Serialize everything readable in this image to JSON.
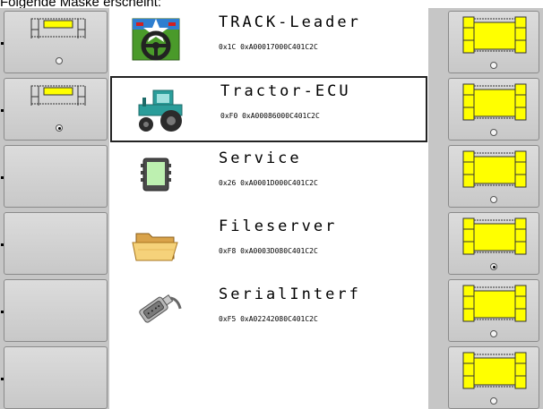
{
  "caption": "Folgende Maske erscheint:",
  "devices": [
    {
      "title": "TRACK-Leader",
      "addr": "0x1C 0xA00017000C401C2C",
      "icon": "steering-wheel-icon"
    },
    {
      "title": "Tractor-ECU",
      "addr": "0xF0 0xA00086000C401C2C",
      "icon": "tractor-icon"
    },
    {
      "title": "Service",
      "addr": "0x26 0xA0001D000C401C2C",
      "icon": "terminal-icon"
    },
    {
      "title": "Fileserver",
      "addr": "0xF8 0xA0003D080C401C2C",
      "icon": "folder-icon"
    },
    {
      "title": "SerialInterf",
      "addr": "0xF5 0xA02242080C401C2C",
      "icon": "serial-plug-icon"
    }
  ],
  "left_softkeys": [
    {
      "icon": "boom-small-icon",
      "radio": "off"
    },
    {
      "icon": "boom-small-icon",
      "radio": "on"
    },
    {
      "icon": "",
      "radio": ""
    },
    {
      "icon": "",
      "radio": ""
    },
    {
      "icon": "",
      "radio": ""
    },
    {
      "icon": "",
      "radio": ""
    }
  ],
  "right_softkeys": [
    {
      "icon": "boom-large-icon",
      "radio": "off"
    },
    {
      "icon": "boom-large-icon",
      "radio": "off"
    },
    {
      "icon": "boom-large-icon",
      "radio": "off"
    },
    {
      "icon": "boom-large-icon",
      "radio": "on"
    },
    {
      "icon": "boom-large-icon",
      "radio": "off"
    },
    {
      "icon": "boom-large-icon",
      "radio": "off"
    }
  ],
  "selected_index": 1,
  "colors": {
    "highlight": "#ffff00",
    "frame": "#c6c6c6",
    "tractor": "#2a9d9a"
  }
}
